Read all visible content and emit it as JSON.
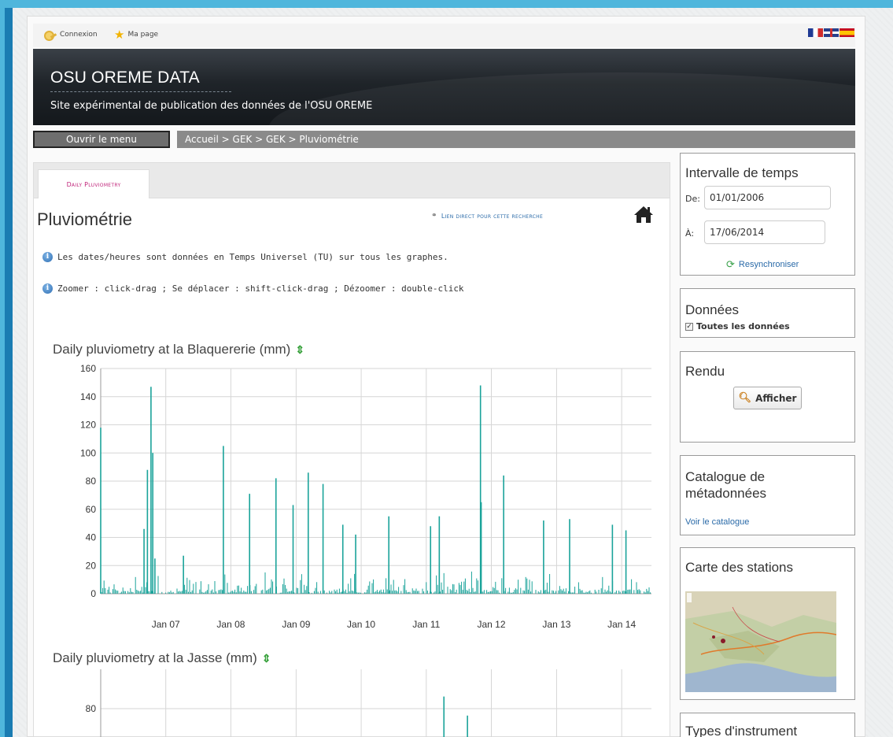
{
  "topbar": {
    "login_label": "Connexion",
    "mypage_label": "Ma page"
  },
  "header": {
    "title": "OSU OREME DATA",
    "subtitle": "Site expérimental de publication des données de l'OSU OREME"
  },
  "nav": {
    "menu_button": "Ouvrir le menu",
    "breadcrumb": "Accueil > GEK > GEK > Pluviométrie"
  },
  "main": {
    "tab_label": "Daily Pluviometry",
    "page_title": "Pluviométrie",
    "direct_link": "Lien direct pour cette recherche",
    "info1": "Les dates/heures sont données en Temps Universel (TU) sur tous les graphes.",
    "info2": "Zoomer : click-drag ; Se déplacer : shift-click-drag ; Dézoomer : double-click"
  },
  "sidebar": {
    "interval_title": "Intervalle de temps",
    "from_label": "De:",
    "from_value": "01/01/2006",
    "to_label": "À:",
    "to_value": "17/06/2014",
    "resync_label": "Resynchroniser",
    "data_title": "Données",
    "all_data_label": "Toutes les données",
    "render_title": "Rendu",
    "show_button": "Afficher",
    "catalog_title": "Catalogue de métadonnées",
    "catalog_link": "Voir le catalogue",
    "map_title": "Carte des stations",
    "instrument_title": "Types d'instrument"
  },
  "colors": {
    "series": "#1aa39a",
    "accent": "#c0247a",
    "link": "#2a6aa8"
  },
  "chart_data": [
    {
      "type": "bar",
      "title": "Daily pluviometry at la Blaquererie (mm)",
      "ylim": [
        0,
        160
      ],
      "yticks": [
        0,
        20,
        40,
        60,
        80,
        100,
        120,
        140,
        160
      ],
      "xticks": [
        "Jan 07",
        "Jan 08",
        "Jan 09",
        "Jan 10",
        "Jan 11",
        "Jan 12",
        "Jan 13",
        "Jan 14"
      ],
      "xrange": [
        "2006-01-01",
        "2014-06-17"
      ],
      "series": [
        {
          "x": [
            "2006-01-01",
            "2006-09-01",
            "2006-09-20",
            "2006-10-10",
            "2006-10-20",
            "2006-11-01",
            "2007-04-10",
            "2007-11-20",
            "2008-04-15",
            "2008-09-10",
            "2008-12-15",
            "2009-03-10",
            "2009-06-01",
            "2009-09-20",
            "2009-12-01",
            "2010-06-05",
            "2011-01-25",
            "2011-03-15",
            "2011-11-01",
            "2011-11-05",
            "2012-03-10",
            "2012-10-20",
            "2013-03-15",
            "2013-11-10",
            "2014-01-25"
          ],
          "values": [
            118,
            46,
            88,
            147,
            100,
            25,
            27,
            105,
            71,
            82,
            63,
            86,
            78,
            49,
            42,
            55,
            48,
            55,
            148,
            65,
            84,
            52,
            53,
            49,
            45
          ]
        }
      ]
    },
    {
      "type": "bar",
      "title": "Daily pluviometry at la Jasse (mm)",
      "yticks": [
        80
      ],
      "series": [
        {
          "x": [
            "2011-04-10",
            "2011-08-20"
          ],
          "values": [
            87,
            76
          ]
        }
      ]
    }
  ]
}
